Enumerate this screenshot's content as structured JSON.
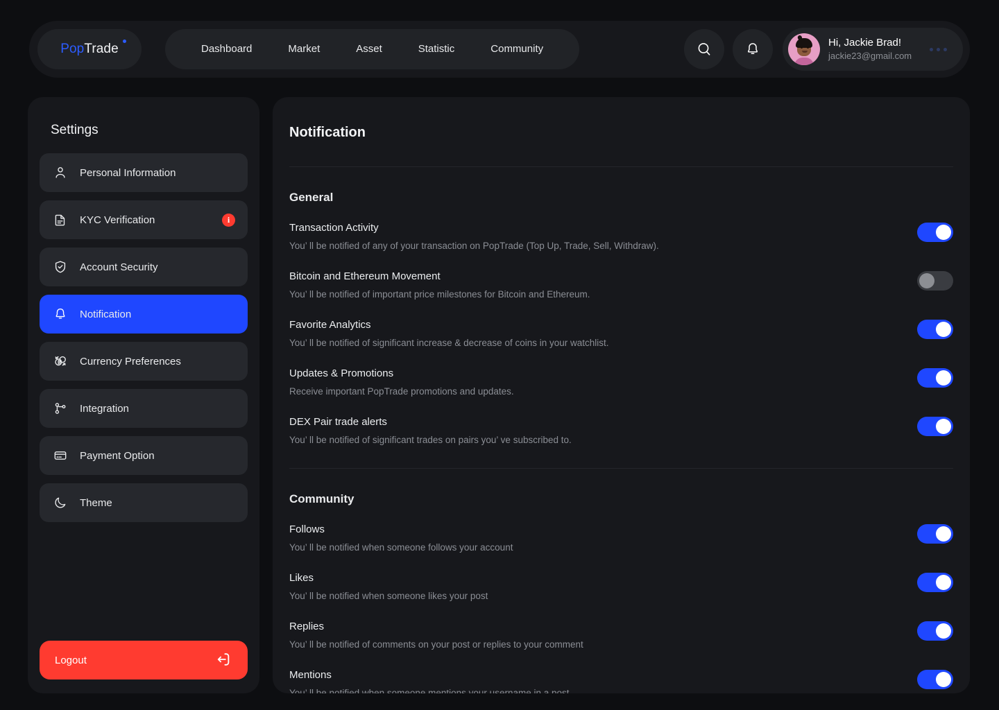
{
  "brand": {
    "part1": "Pop",
    "part2": "Trade"
  },
  "nav": {
    "items": [
      {
        "label": "Dashboard"
      },
      {
        "label": "Market"
      },
      {
        "label": "Asset"
      },
      {
        "label": "Statistic"
      },
      {
        "label": "Community"
      }
    ]
  },
  "header": {
    "search_icon": "search-icon",
    "bell_icon": "bell-icon",
    "more_icon": "more-options-icon",
    "user": {
      "greeting": "Hi, Jackie Brad!",
      "email": "jackie23@gmail.com",
      "avatar_bg": "#e79ec5"
    }
  },
  "sidebar": {
    "title": "Settings",
    "items": [
      {
        "label": "Personal Information",
        "icon": "user-icon",
        "active": false,
        "badge": ""
      },
      {
        "label": "KYC Verification",
        "icon": "document-icon",
        "active": false,
        "badge": "i"
      },
      {
        "label": "Account Security",
        "icon": "shield-check-icon",
        "active": false,
        "badge": ""
      },
      {
        "label": "Notification",
        "icon": "bell-icon",
        "active": true,
        "badge": ""
      },
      {
        "label": "Currency Preferences",
        "icon": "currency-exchange-icon",
        "active": false,
        "badge": ""
      },
      {
        "label": "Integration",
        "icon": "git-branch-icon",
        "active": false,
        "badge": ""
      },
      {
        "label": "Payment Option",
        "icon": "credit-card-icon",
        "active": false,
        "badge": ""
      },
      {
        "label": "Theme",
        "icon": "moon-icon",
        "active": false,
        "badge": ""
      }
    ],
    "logout": {
      "label": "Logout",
      "icon": "logout-icon",
      "color": "#ff3b30"
    }
  },
  "main": {
    "title": "Notification",
    "sections": [
      {
        "title": "General",
        "rows": [
          {
            "title": "Transaction Activity",
            "desc": "You’  ll be notified of any of your transaction on PopTrade (Top Up, Trade, Sell, Withdraw).",
            "enabled": true
          },
          {
            "title": "Bitcoin and Ethereum Movement",
            "desc": "You’  ll be notified of important price milestones for Bitcoin and Ethereum.",
            "enabled": false
          },
          {
            "title": "Favorite Analytics",
            "desc": "You’  ll be notified of significant increase & decrease of coins in your watchlist.",
            "enabled": true
          },
          {
            "title": "Updates & Promotions",
            "desc": "Receive important PopTrade promotions and updates.",
            "enabled": true
          },
          {
            "title": "DEX Pair trade alerts",
            "desc": "You’  ll be notified of significant trades on pairs you’  ve subscribed to.",
            "enabled": true
          }
        ]
      },
      {
        "title": "Community",
        "rows": [
          {
            "title": "Follows",
            "desc": "You’  ll be notified when someone follows your account",
            "enabled": true
          },
          {
            "title": "Likes",
            "desc": "You’  ll be notified when someone likes your post",
            "enabled": true
          },
          {
            "title": "Replies",
            "desc": "You’  ll be notified of comments on your post or replies to your comment",
            "enabled": true
          },
          {
            "title": "Mentions",
            "desc": "You’  ll be notified when someone mentions your username in a post",
            "enabled": true
          }
        ]
      }
    ]
  },
  "colors": {
    "page_bg": "#0d0e11",
    "panel_bg": "#17181c",
    "item_bg": "#26282d",
    "accent_blue": "#1f47ff",
    "logo_blue": "#2c5cff",
    "danger_red": "#ff3b30",
    "text_primary": "#eceef0",
    "text_muted": "#8b8e95"
  }
}
